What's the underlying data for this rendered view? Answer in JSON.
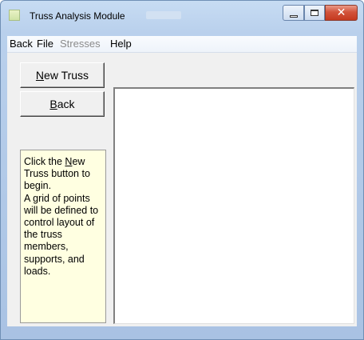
{
  "window": {
    "title": "Truss Analysis Module"
  },
  "menu": [
    {
      "label": "Back",
      "disabled": false
    },
    {
      "label": "File",
      "disabled": false
    },
    {
      "label": "Stresses",
      "disabled": true
    },
    {
      "label": "Help",
      "disabled": false
    }
  ],
  "buttons": {
    "new_truss": {
      "prefix": "",
      "accel": "N",
      "rest": "ew Truss"
    },
    "back": {
      "prefix": "",
      "accel": "B",
      "rest": "ack"
    }
  },
  "help": {
    "line1_prefix": "Click the ",
    "line1_accel": "N",
    "line1_rest": "ew",
    "line2": "Truss button to begin.",
    "body": "A grid of points will be defined to control layout of the truss members, supports, and loads."
  },
  "colors": {
    "help_bg": "#ffffe1",
    "close_button": "#c5391f"
  },
  "icons": [
    "app-icon",
    "minimize-icon",
    "maximize-icon",
    "close-icon"
  ]
}
